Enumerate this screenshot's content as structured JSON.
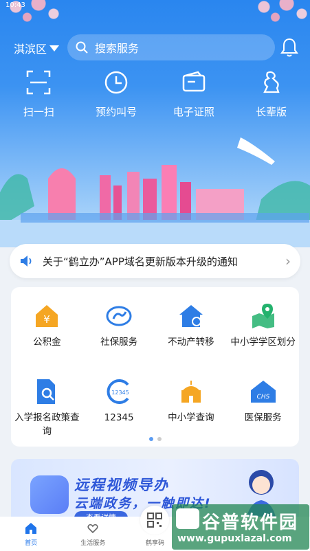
{
  "status": {
    "time": "10:43"
  },
  "topbar": {
    "region": "淇滨区",
    "search_placeholder": "搜索服务"
  },
  "quick_actions": [
    {
      "label": "扫一扫",
      "icon": "scan-icon"
    },
    {
      "label": "预约叫号",
      "icon": "clock-icon"
    },
    {
      "label": "电子证照",
      "icon": "wallet-icon"
    },
    {
      "label": "长辈版",
      "icon": "elder-icon"
    }
  ],
  "notice": {
    "text": "关于“鹤立办”APP域名更新版本升级的通知"
  },
  "services": [
    {
      "label": "公积金",
      "icon": "housing-fund-icon",
      "color": "#f5a623"
    },
    {
      "label": "社保服务",
      "icon": "social-security-icon",
      "color": "#2e7de5"
    },
    {
      "label": "不动产转移",
      "icon": "house-transfer-icon",
      "color": "#2e7de5"
    },
    {
      "label": "中小学学区划分",
      "icon": "map-pin-icon",
      "color": "#23b26d"
    },
    {
      "label": "入学报名政策查询",
      "icon": "document-search-icon",
      "color": "#2e7de5"
    },
    {
      "label": "12345",
      "icon": "hotline-icon",
      "color": "#2e7de5",
      "icon_text": "12345"
    },
    {
      "label": "中小学查询",
      "icon": "school-icon",
      "color": "#f5a623"
    },
    {
      "label": "医保服务",
      "icon": "medical-insurance-icon",
      "color": "#2e7de5",
      "icon_text": "CHS"
    }
  ],
  "pager": {
    "pages": 2,
    "active": 0
  },
  "banner": {
    "line1": "远程视频导办",
    "line2": "云端政务，一触即达!",
    "button": "查看详情"
  },
  "tabbar": [
    {
      "label": "首页",
      "icon": "home-icon",
      "active": true
    },
    {
      "label": "生活服务",
      "icon": "heart-hand-icon",
      "active": false
    },
    {
      "label": "鹤享码",
      "icon": "qr-code-icon",
      "active": false
    }
  ],
  "watermark": {
    "line1": "谷普软件园",
    "line2": "www.gupuxlazal.com"
  },
  "colors": {
    "primary": "#2a86ef",
    "accent": "#1f74ea"
  }
}
